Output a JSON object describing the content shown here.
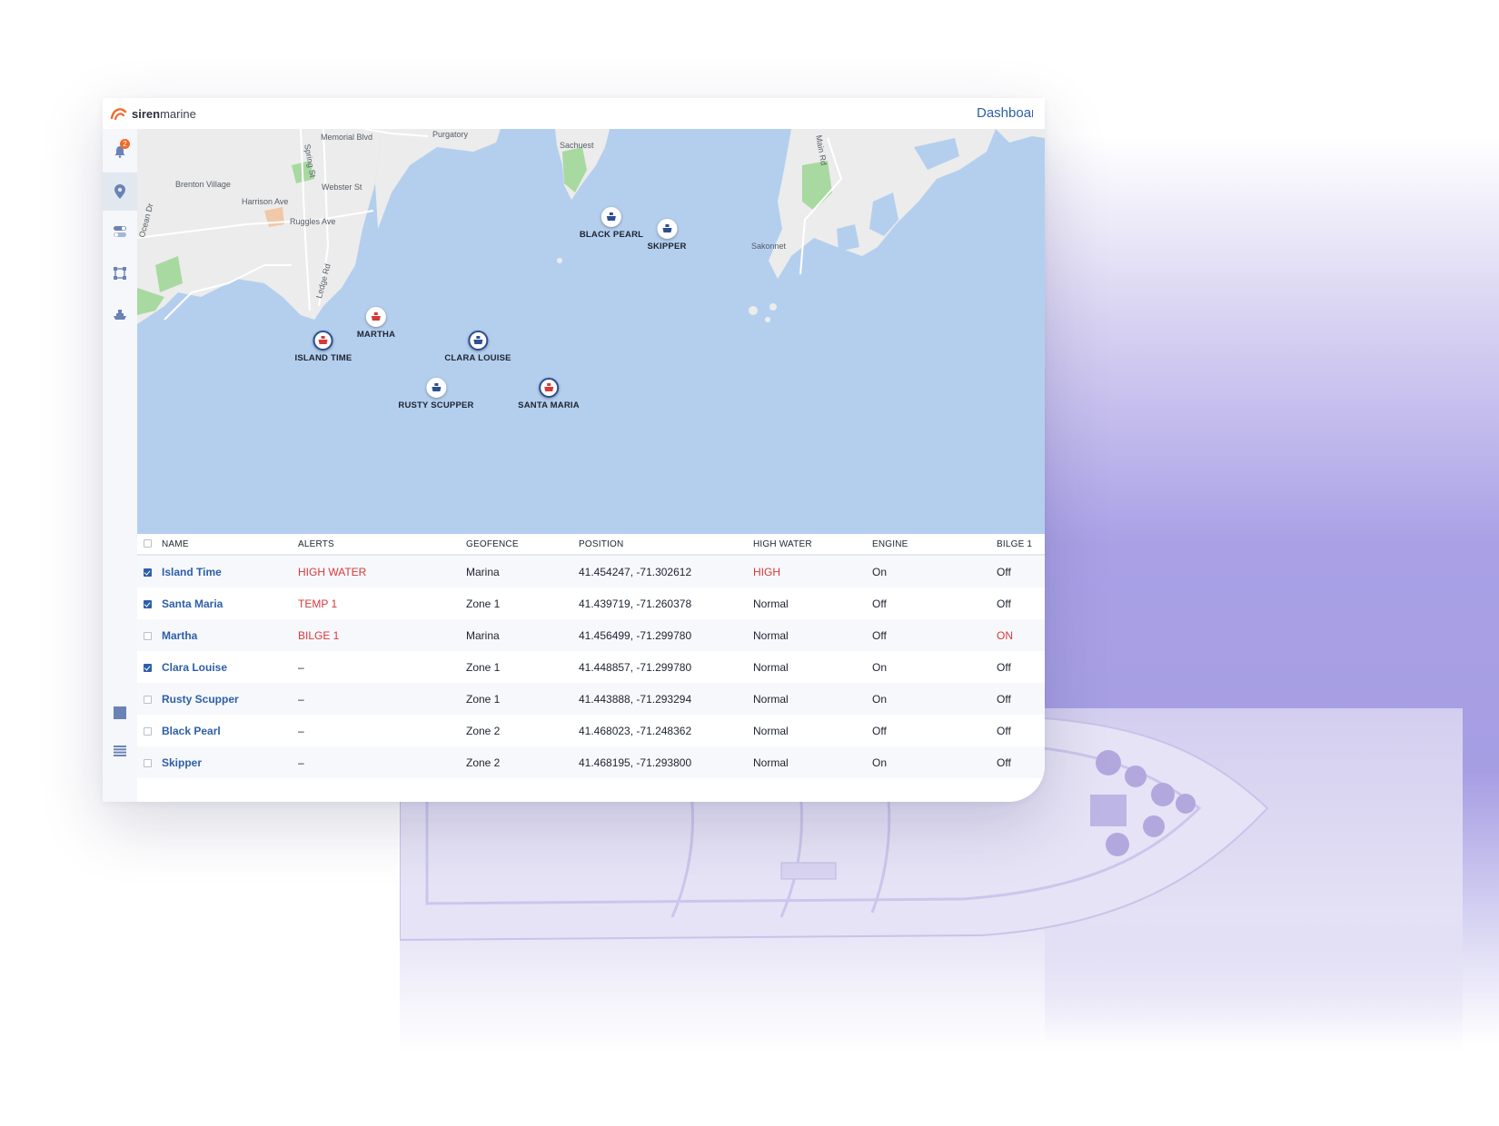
{
  "app": {
    "brand_bold": "siren",
    "brand_rest": "marine",
    "top_link": "Dashboard",
    "alert_count": "2"
  },
  "sidebar": [
    {
      "icon": "bell-icon"
    },
    {
      "icon": "map-pin-icon",
      "active": true
    },
    {
      "icon": "toggle-icon"
    },
    {
      "icon": "geofence-icon"
    },
    {
      "icon": "boat-icon"
    },
    {
      "icon": "square-icon"
    },
    {
      "icon": "list-icon"
    }
  ],
  "map": {
    "places": [
      "Memorial Blvd",
      "Purgatory",
      "Sachuest",
      "Main Rd",
      "Brenton Village",
      "Spring St",
      "Webster St",
      "Harrison Ave",
      "Ruggles Ave",
      "Ledge Rd",
      "Sakonnet",
      "Ocean Dr"
    ],
    "vessels": [
      {
        "name": "BLACK PEARL",
        "status": "normal",
        "color": "#2d4f93"
      },
      {
        "name": "SKIPPER",
        "status": "normal",
        "color": "#2d4f93"
      },
      {
        "name": "MARTHA",
        "status": "alert",
        "color": "#d63939"
      },
      {
        "name": "ISLAND TIME",
        "status": "alert",
        "color": "#d63939"
      },
      {
        "name": "CLARA LOUISE",
        "status": "normal",
        "color": "#2d4f93"
      },
      {
        "name": "RUSTY SCUPPER",
        "status": "normal",
        "color": "#2d4f93"
      },
      {
        "name": "SANTA MARIA",
        "status": "alert",
        "color": "#d63939"
      }
    ]
  },
  "table": {
    "columns": [
      "NAME",
      "ALERTS",
      "GEOFENCE",
      "POSITION",
      "HIGH WATER",
      "ENGINE",
      "BILGE 1"
    ],
    "rows": [
      {
        "checked": true,
        "name": "Island Time",
        "alerts": "HIGH WATER",
        "geofence": "Marina",
        "position": "41.454247, -71.302612",
        "high_water": "HIGH",
        "engine": "On",
        "bilge": "Off"
      },
      {
        "checked": true,
        "name": "Santa Maria",
        "alerts": "TEMP 1",
        "geofence": "Zone 1",
        "position": "41.439719, -71.260378",
        "high_water": "Normal",
        "engine": "Off",
        "bilge": "Off"
      },
      {
        "checked": false,
        "name": "Martha",
        "alerts": "BILGE 1",
        "geofence": "Marina",
        "position": "41.456499, -71.299780",
        "high_water": "Normal",
        "engine": "Off",
        "bilge": "ON"
      },
      {
        "checked": true,
        "name": "Clara Louise",
        "alerts": "–",
        "geofence": "Zone 1",
        "position": "41.448857, -71.299780",
        "high_water": "Normal",
        "engine": "On",
        "bilge": "Off"
      },
      {
        "checked": false,
        "name": "Rusty Scupper",
        "alerts": "–",
        "geofence": "Zone 1",
        "position": "41.443888, -71.293294",
        "high_water": "Normal",
        "engine": "On",
        "bilge": "Off"
      },
      {
        "checked": false,
        "name": "Black Pearl",
        "alerts": "–",
        "geofence": "Zone 2",
        "position": "41.468023, -71.248362",
        "high_water": "Normal",
        "engine": "Off",
        "bilge": "Off"
      },
      {
        "checked": false,
        "name": "Skipper",
        "alerts": "–",
        "geofence": "Zone 2",
        "position": "41.468195, -71.293800",
        "high_water": "Normal",
        "engine": "On",
        "bilge": "Off"
      }
    ]
  },
  "colors": {
    "alert": "#d63939",
    "link": "#2d5fa8",
    "water": "#b4cfee",
    "land": "#ececec",
    "park": "#a8d9a0",
    "brand_orange": "#f26a2a"
  }
}
